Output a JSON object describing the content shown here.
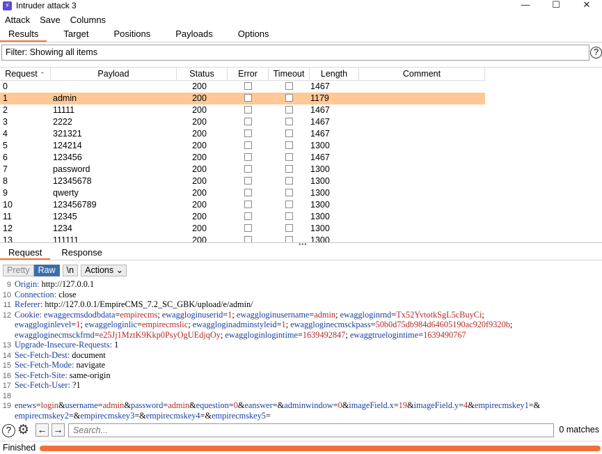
{
  "window": {
    "title": "Intruder attack 3",
    "icon": "burp-lightning-icon",
    "controls": [
      "—",
      "☐",
      "✕"
    ]
  },
  "menu": [
    "Attack",
    "Save",
    "Columns"
  ],
  "tabs": [
    {
      "label": "Results",
      "active": true
    },
    {
      "label": "Target",
      "active": false
    },
    {
      "label": "Positions",
      "active": false
    },
    {
      "label": "Payloads",
      "active": false
    },
    {
      "label": "Options",
      "active": false
    }
  ],
  "filter": {
    "text": "Filter: Showing all items",
    "help": "?"
  },
  "table": {
    "columns": [
      "Request",
      "Payload",
      "Status",
      "Error",
      "Timeout",
      "Length",
      "Comment"
    ],
    "sort_indicator": "^",
    "rows": [
      {
        "request": "0",
        "payload": "",
        "status": "200",
        "length": "1467",
        "selected": false
      },
      {
        "request": "1",
        "payload": "admin",
        "status": "200",
        "length": "1179",
        "selected": true
      },
      {
        "request": "2",
        "payload": "11111",
        "status": "200",
        "length": "1467",
        "selected": false
      },
      {
        "request": "3",
        "payload": "2222",
        "status": "200",
        "length": "1467",
        "selected": false
      },
      {
        "request": "4",
        "payload": "321321",
        "status": "200",
        "length": "1467",
        "selected": false
      },
      {
        "request": "5",
        "payload": "124214",
        "status": "200",
        "length": "1300",
        "selected": false
      },
      {
        "request": "6",
        "payload": "123456",
        "status": "200",
        "length": "1467",
        "selected": false
      },
      {
        "request": "7",
        "payload": "password",
        "status": "200",
        "length": "1300",
        "selected": false
      },
      {
        "request": "8",
        "payload": "12345678",
        "status": "200",
        "length": "1300",
        "selected": false
      },
      {
        "request": "9",
        "payload": "qwerty",
        "status": "200",
        "length": "1300",
        "selected": false
      },
      {
        "request": "10",
        "payload": "123456789",
        "status": "200",
        "length": "1300",
        "selected": false
      },
      {
        "request": "11",
        "payload": "12345",
        "status": "200",
        "length": "1300",
        "selected": false
      },
      {
        "request": "12",
        "payload": "1234",
        "status": "200",
        "length": "1300",
        "selected": false
      },
      {
        "request": "13",
        "payload": "111111",
        "status": "200",
        "length": "1300",
        "selected": false
      }
    ]
  },
  "lower_tabs": [
    {
      "label": "Request",
      "active": true
    },
    {
      "label": "Response",
      "active": false
    }
  ],
  "editor_toolbar": {
    "pretty": "Pretty",
    "raw": "Raw",
    "newline": "\\n",
    "actions": "Actions"
  },
  "editor": {
    "lines": [
      {
        "n": "9",
        "parts": [
          {
            "t": "Origin: ",
            "c": "k"
          },
          {
            "t": "http://127.0.0.1",
            "c": ""
          }
        ]
      },
      {
        "n": "10",
        "parts": [
          {
            "t": "Connection: ",
            "c": "k"
          },
          {
            "t": "close",
            "c": ""
          }
        ]
      },
      {
        "n": "11",
        "parts": [
          {
            "t": "Referer: ",
            "c": "k"
          },
          {
            "t": "http://127.0.0.1/EmpireCMS_7.2_SC_GBK/upload/e/admin/",
            "c": ""
          }
        ]
      },
      {
        "n": "12",
        "parts": [
          {
            "t": "Cookie: ",
            "c": "k"
          },
          {
            "t": "ewaggecmsdodbdata",
            "c": "k"
          },
          {
            "t": "=",
            "c": ""
          },
          {
            "t": "empirecms",
            "c": "v"
          },
          {
            "t": "; ",
            "c": ""
          },
          {
            "t": "ewaggloginuserid",
            "c": "k"
          },
          {
            "t": "=",
            "c": ""
          },
          {
            "t": "1",
            "c": "v"
          },
          {
            "t": "; ",
            "c": ""
          },
          {
            "t": "ewaggloginusername",
            "c": "k"
          },
          {
            "t": "=",
            "c": ""
          },
          {
            "t": "admin",
            "c": "v"
          },
          {
            "t": "; ",
            "c": ""
          },
          {
            "t": "ewaggloginrnd",
            "c": "k"
          },
          {
            "t": "=",
            "c": ""
          },
          {
            "t": "Tx52YvtotkSgL5cBuyCi",
            "c": "v"
          },
          {
            "t": ";",
            "c": ""
          }
        ]
      },
      {
        "n": "",
        "parts": [
          {
            "t": "ewaggloginlevel",
            "c": "k"
          },
          {
            "t": "=",
            "c": ""
          },
          {
            "t": "1",
            "c": "v"
          },
          {
            "t": "; ",
            "c": ""
          },
          {
            "t": "ewaggeloginlic",
            "c": "k"
          },
          {
            "t": "=",
            "c": ""
          },
          {
            "t": "empirecmslic",
            "c": "v"
          },
          {
            "t": "; ",
            "c": ""
          },
          {
            "t": "ewaggloginadminstyleid",
            "c": "k"
          },
          {
            "t": "=",
            "c": ""
          },
          {
            "t": "1",
            "c": "v"
          },
          {
            "t": "; ",
            "c": ""
          },
          {
            "t": "ewaggloginecmsckpass",
            "c": "k"
          },
          {
            "t": "=",
            "c": ""
          },
          {
            "t": "50b0d75db984d64605190ac920f9320b",
            "c": "v"
          },
          {
            "t": ";",
            "c": ""
          }
        ]
      },
      {
        "n": "",
        "parts": [
          {
            "t": "ewaggloginecmsckfrnd",
            "c": "k"
          },
          {
            "t": "=",
            "c": ""
          },
          {
            "t": "e25Jj1MztK9Kkp0PsyOgUEdjqOy",
            "c": "v"
          },
          {
            "t": "; ",
            "c": ""
          },
          {
            "t": "ewaggloginlogintime",
            "c": "k"
          },
          {
            "t": "=",
            "c": ""
          },
          {
            "t": "1639492847",
            "c": "v"
          },
          {
            "t": "; ",
            "c": ""
          },
          {
            "t": "ewaggtruelogintime",
            "c": "k"
          },
          {
            "t": "=",
            "c": ""
          },
          {
            "t": "1639490767",
            "c": "v"
          }
        ]
      },
      {
        "n": "13",
        "parts": [
          {
            "t": "Upgrade-Insecure-Requests: ",
            "c": "k"
          },
          {
            "t": "1",
            "c": ""
          }
        ]
      },
      {
        "n": "14",
        "parts": [
          {
            "t": "Sec-Fetch-Dest: ",
            "c": "k"
          },
          {
            "t": "document",
            "c": ""
          }
        ]
      },
      {
        "n": "15",
        "parts": [
          {
            "t": "Sec-Fetch-Mode: ",
            "c": "k"
          },
          {
            "t": "navigate",
            "c": ""
          }
        ]
      },
      {
        "n": "16",
        "parts": [
          {
            "t": "Sec-Fetch-Site: ",
            "c": "k"
          },
          {
            "t": "same-origin",
            "c": ""
          }
        ]
      },
      {
        "n": "17",
        "parts": [
          {
            "t": "Sec-Fetch-User: ",
            "c": "k"
          },
          {
            "t": "?1",
            "c": ""
          }
        ]
      },
      {
        "n": "18",
        "parts": []
      },
      {
        "n": "19",
        "parts": [
          {
            "t": "enews",
            "c": "k"
          },
          {
            "t": "=",
            "c": ""
          },
          {
            "t": "login",
            "c": "v"
          },
          {
            "t": "&",
            "c": ""
          },
          {
            "t": "username",
            "c": "k"
          },
          {
            "t": "=",
            "c": ""
          },
          {
            "t": "admin",
            "c": "v"
          },
          {
            "t": "&",
            "c": ""
          },
          {
            "t": "password",
            "c": "k"
          },
          {
            "t": "=",
            "c": ""
          },
          {
            "t": "admin",
            "c": "v"
          },
          {
            "t": "&",
            "c": ""
          },
          {
            "t": "equestion",
            "c": "k"
          },
          {
            "t": "=",
            "c": ""
          },
          {
            "t": "0",
            "c": "v"
          },
          {
            "t": "&",
            "c": ""
          },
          {
            "t": "eanswer",
            "c": "k"
          },
          {
            "t": "=&",
            "c": ""
          },
          {
            "t": "adminwindow",
            "c": "k"
          },
          {
            "t": "=",
            "c": ""
          },
          {
            "t": "0",
            "c": "v"
          },
          {
            "t": "&",
            "c": ""
          },
          {
            "t": "imageField.x",
            "c": "k"
          },
          {
            "t": "=",
            "c": ""
          },
          {
            "t": "19",
            "c": "v"
          },
          {
            "t": "&",
            "c": ""
          },
          {
            "t": "imageField.y",
            "c": "k"
          },
          {
            "t": "=",
            "c": ""
          },
          {
            "t": "4",
            "c": "v"
          },
          {
            "t": "&",
            "c": ""
          },
          {
            "t": "empirecmskey1",
            "c": "k"
          },
          {
            "t": "=&",
            "c": ""
          }
        ]
      },
      {
        "n": "",
        "parts": [
          {
            "t": "empirecmskey2",
            "c": "k"
          },
          {
            "t": "=&",
            "c": ""
          },
          {
            "t": "empirecmskey3",
            "c": "k"
          },
          {
            "t": "=&",
            "c": ""
          },
          {
            "t": "empirecmskey4",
            "c": "k"
          },
          {
            "t": "=&",
            "c": ""
          },
          {
            "t": "empirecmskey5",
            "c": "k"
          },
          {
            "t": "=",
            "c": ""
          }
        ]
      }
    ]
  },
  "search": {
    "placeholder": "Search...",
    "matches": "0 matches"
  },
  "status": {
    "text": "Finished",
    "progress_fraction": 1.0,
    "progress_color": "#f0703a"
  },
  "colors": {
    "accent": "#f07a3c",
    "selected_row": "#ffc896",
    "raw_button": "#3c6fa8"
  }
}
